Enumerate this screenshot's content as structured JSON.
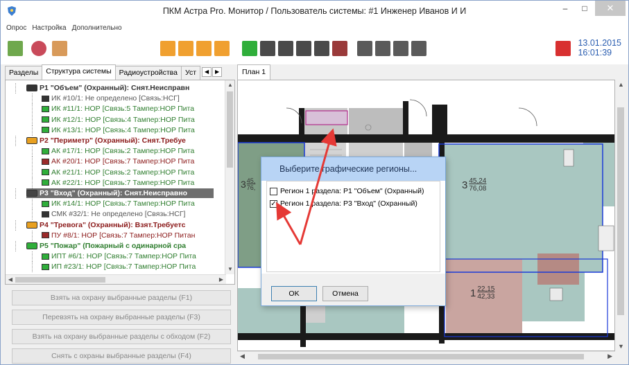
{
  "window": {
    "title": "ПКМ Астра Pro. Монитор / Пользователь системы: #1 Инженер Иванов И И",
    "min_icon": "minimize-icon",
    "max_icon": "maximize-icon",
    "close_icon": "close-icon"
  },
  "menu": [
    "Опрос",
    "Настройка",
    "Дополнительно"
  ],
  "datetime": {
    "date": "13.01.2015",
    "time": "16:01:39"
  },
  "left_tabs": [
    "Разделы",
    "Структура системы",
    "Радиоустройства",
    "Уст"
  ],
  "tree": [
    {
      "kind": "part",
      "text": "P1 \"Объем\" (Охранный): Снят.Неисправн",
      "color": "#333333"
    },
    {
      "kind": "dev",
      "text": "ИК #10/1: Не определено [Связь:НСГ]",
      "color": "#555555"
    },
    {
      "kind": "dev",
      "text": "ИК #11/1: НОР [Связь:5 Тампер:НОР Пита",
      "color": "#2e7d2e"
    },
    {
      "kind": "dev",
      "text": "ИК #12/1: НОР [Связь:4 Тампер:НОР Пита",
      "color": "#2e7d2e"
    },
    {
      "kind": "dev",
      "text": "ИК #13/1: НОР [Связь:4 Тампер:НОР Пита",
      "color": "#2e7d2e"
    },
    {
      "kind": "part",
      "text": "P2 \"Периметр\" (Охранный): Снят.Требуе",
      "color": "#8b1a1a"
    },
    {
      "kind": "dev",
      "text": "АК #17/1: НОР [Связь:2 Тампер:НОР Пита",
      "color": "#2e7d2e"
    },
    {
      "kind": "dev",
      "text": "АК #20/1: НОР [Связь:7 Тампер:НОР Пита",
      "color": "#8b1a1a"
    },
    {
      "kind": "dev",
      "text": "АК #21/1: НОР [Связь:2 Тампер:НОР Пита",
      "color": "#2e7d2e"
    },
    {
      "kind": "dev",
      "text": "АК #22/1: НОР [Связь:7 Тампер:НОР Пита",
      "color": "#2e7d2e"
    },
    {
      "kind": "part-sel",
      "text": "P3 \"Вход\" (Охранный): Снят.Неисправно",
      "color": "#ffffff"
    },
    {
      "kind": "dev",
      "text": "ИК #14/1: НОР [Связь:7 Тампер:НОР Пита",
      "color": "#2e7d2e"
    },
    {
      "kind": "dev",
      "text": "СМК #32/1: Не определено [Связь:НСГ]",
      "color": "#555555"
    },
    {
      "kind": "part",
      "text": "P4 \"Тревога\" (Охранный): Взят.Требуетс",
      "color": "#8b1a1a"
    },
    {
      "kind": "dev",
      "text": "ПУ #8/1: НОР [Связь:7 Тампер:НОР Питан",
      "color": "#8b1a1a"
    },
    {
      "kind": "part",
      "text": "P5 \"Пожар\" (Пожарный с одинарной сра",
      "color": "#2e7d2e"
    },
    {
      "kind": "dev",
      "text": "ИПТ #6/1: НОР [Связь:7 Тампер:НОР Пита",
      "color": "#2e7d2e"
    },
    {
      "kind": "dev",
      "text": "ИП #23/1: НОР [Связь:7 Тампер:НОР Пита",
      "color": "#2e7d2e"
    }
  ],
  "actions": [
    "Взять на охрану выбранные разделы (F1)",
    "Перевзять на охрану выбранные разделы (F3)",
    "Взять на охрану выбранные разделы с обходом (F2)",
    "Снять с охраны выбранные разделы (F4)"
  ],
  "plan_tab": "План 1",
  "rooms": [
    {
      "label": "3",
      "num": "45,24",
      "den": "76,08"
    },
    {
      "label": "1",
      "num": "22,15",
      "den": "42,33"
    },
    {
      "label": "3",
      "num": "45,",
      "den": "76,"
    }
  ],
  "dialog": {
    "title": "Выберите графические регионы...",
    "items": [
      {
        "label": "Регион 1 раздела: P1 \"Объем\" (Охранный)",
        "checked": false
      },
      {
        "label": "Регион 1 раздела: P3 \"Вход\" (Охранный)",
        "checked": true
      }
    ],
    "ok": "OK",
    "cancel": "Отмена"
  },
  "colors": {
    "accent": "#2a5db0",
    "toolbar_orange": "#f0a030",
    "toolbar_green": "#2fae3a",
    "highlight_red": "#e53935",
    "dialog_title_bg": "#b8d4f5"
  }
}
